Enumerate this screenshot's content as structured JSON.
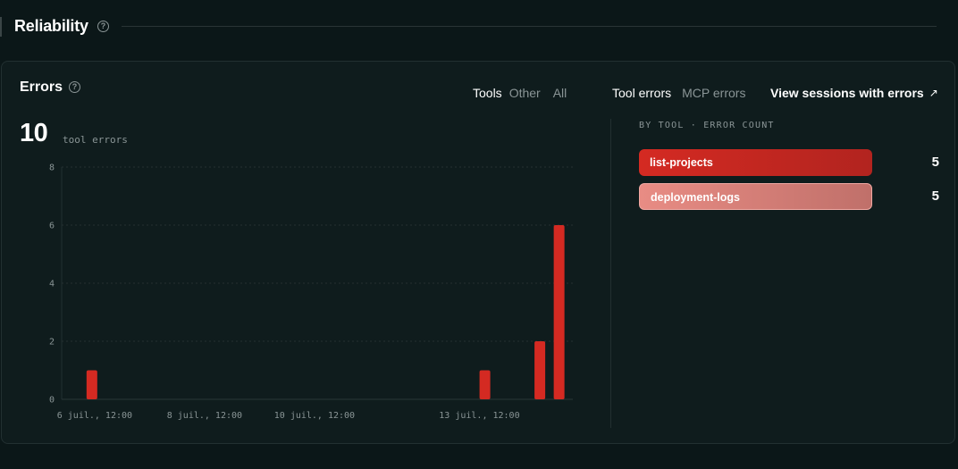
{
  "section": {
    "title": "Reliability",
    "help_icon": "?"
  },
  "card": {
    "title": "Errors",
    "help_icon": "?",
    "scope_toggles": [
      {
        "label": "Tools",
        "active": true
      },
      {
        "label": "Other",
        "active": false
      },
      {
        "label": "All",
        "active": false
      }
    ],
    "type_toggles": [
      {
        "label": "Tool errors",
        "active": true
      },
      {
        "label": "MCP errors",
        "active": false
      }
    ],
    "sessions_link": {
      "label": "View sessions with errors",
      "icon": "↗"
    },
    "total": {
      "value": "10",
      "label": "tool errors"
    },
    "breakdown": {
      "header": "BY TOOL · ERROR COUNT",
      "rows": [
        {
          "tool": "list-projects",
          "count": "5",
          "style": "primary"
        },
        {
          "tool": "deployment-logs",
          "count": "5",
          "style": "secondary"
        }
      ]
    }
  },
  "colors": {
    "background": "#0b1718",
    "card": "#0f1c1d",
    "bar": "#d42a22",
    "muted_text": "#8a9596"
  },
  "chart_data": {
    "type": "bar",
    "title": "",
    "xlabel": "",
    "ylabel": "",
    "ylim": [
      0,
      8
    ],
    "yticks": [
      "0",
      "2",
      "4",
      "6",
      "8"
    ],
    "x_tick_labels": [
      "6 juil., 12:00",
      "8 juil., 12:00",
      "10 juil., 12:00",
      "13 juil., 12:00"
    ],
    "x_tick_positions": [
      6.5,
      8.5,
      10.5,
      13.5
    ],
    "x_range": [
      5.9,
      15.2
    ],
    "grid": true,
    "series": [
      {
        "x": [
          6.45,
          13.6,
          14.6,
          14.95
        ],
        "values": [
          1,
          1,
          2,
          6
        ]
      }
    ]
  }
}
